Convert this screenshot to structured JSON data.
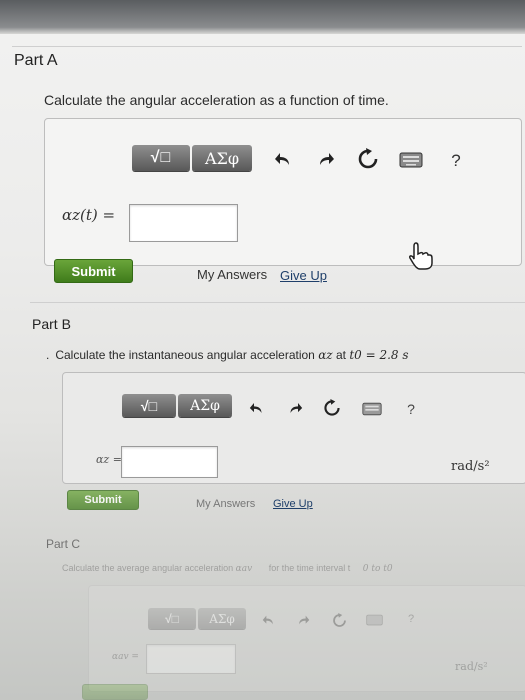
{
  "partA": {
    "title": "Part A",
    "prompt": "Calculate the angular acceleration as a function of time.",
    "answer_label": "αz(t) =",
    "answer_value": "",
    "toolbar": {
      "templates_label": "√□",
      "symbols_label": "ΑΣφ",
      "help_label": "?"
    },
    "submit_label": "Submit",
    "my_answers_label": "My Answers",
    "give_up_label": "Give Up"
  },
  "partB": {
    "title": "Part B",
    "prompt_lead": "Calculate the instantaneous angular acceleration",
    "prompt_symbol": "αz",
    "prompt_at": "at",
    "prompt_time": "t0 = 2.8 s",
    "answer_label": "αz =",
    "answer_value": "",
    "units": "rad/s²",
    "toolbar": {
      "templates_label": "√□",
      "symbols_label": "ΑΣφ",
      "help_label": "?"
    },
    "submit_label": "Submit",
    "my_answers_label": "My Answers",
    "give_up_label": "Give Up"
  },
  "partC": {
    "title": "Part C",
    "prompt_lead": "Calculate the average angular acceleration",
    "prompt_symbol": "αav",
    "prompt_interval": "for the time interval t",
    "prompt_range": "0 to t0",
    "answer_label": "αav =",
    "units": "rad/s²",
    "toolbar": {
      "templates_label": "√□",
      "symbols_label": "ΑΣφ",
      "help_label": "?"
    }
  },
  "colors": {
    "submit": "#4a8a24",
    "toolbar": "#6b6b6b",
    "link": "#1f3f6a"
  },
  "icons": [
    "templates-icon",
    "greek-symbols-icon",
    "undo-icon",
    "redo-icon",
    "reset-icon",
    "keyboard-icon",
    "help-icon",
    "mouse-cursor-icon"
  ]
}
